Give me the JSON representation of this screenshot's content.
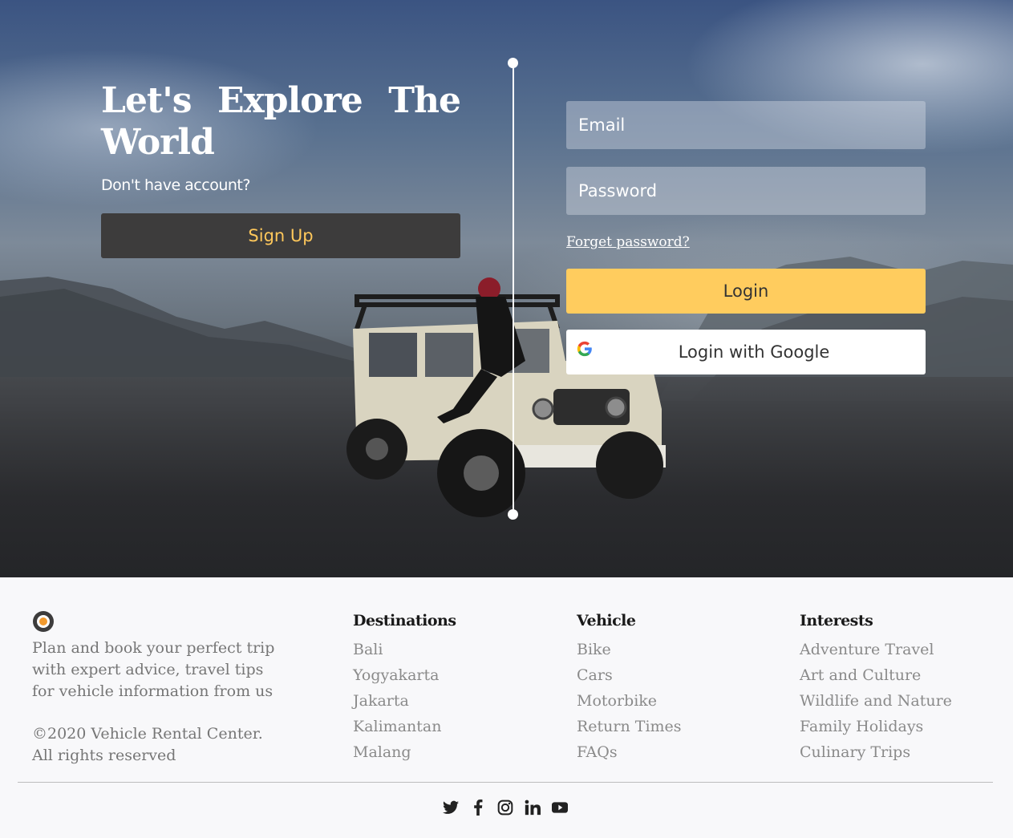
{
  "hero": {
    "title": "Let's Explore The World",
    "subtitle": "Don't have account?",
    "signup_label": "Sign Up"
  },
  "login_form": {
    "email_placeholder": "Email",
    "password_placeholder": "Password",
    "forget_label": "Forget password?",
    "login_label": "Login",
    "google_label": "Login with Google"
  },
  "footer": {
    "about": "Plan and book your perfect trip with expert advice, travel tips for vehicle information from us",
    "copyright": "©2020 Vehicle Rental Center. All rights reserved",
    "columns": [
      {
        "title": "Destinations",
        "items": [
          "Bali",
          "Yogyakarta",
          "Jakarta",
          "Kalimantan",
          "Malang"
        ]
      },
      {
        "title": "Vehicle",
        "items": [
          "Bike",
          "Cars",
          "Motorbike",
          "Return Times",
          "FAQs"
        ]
      },
      {
        "title": "Interests",
        "items": [
          "Adventure Travel",
          "Art and Culture",
          "Wildlife and Nature",
          "Family Holidays",
          "Culinary Trips"
        ]
      }
    ],
    "social": [
      "twitter-icon",
      "facebook-icon",
      "instagram-icon",
      "linkedin-icon",
      "youtube-icon"
    ]
  },
  "colors": {
    "accent": "#ffcc5e",
    "signup_bg": "#3d3c3c",
    "signup_text": "#ffc85b",
    "footer_bg": "#f8f8fa"
  }
}
